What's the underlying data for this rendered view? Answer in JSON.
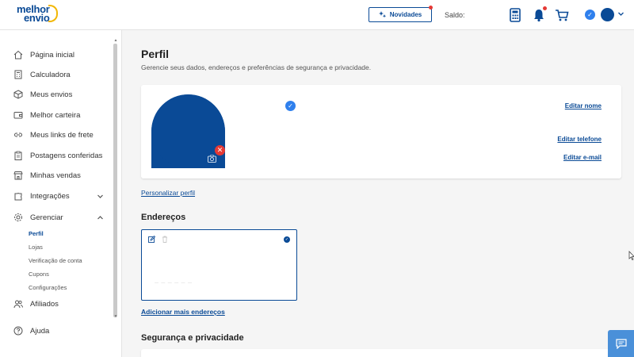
{
  "header": {
    "logo_line1": "melhor",
    "logo_line2": "envio",
    "novidades_label": "Novidades",
    "saldo_label": "Saldo:"
  },
  "sidebar": {
    "items": [
      {
        "label": "Página inicial",
        "icon": "home-icon"
      },
      {
        "label": "Calculadora",
        "icon": "calculator-icon"
      },
      {
        "label": "Meus envios",
        "icon": "box-icon"
      },
      {
        "label": "Melhor carteira",
        "icon": "wallet-icon"
      },
      {
        "label": "Meus links de frete",
        "icon": "link-icon"
      },
      {
        "label": "Postagens conferidas",
        "icon": "clipboard-icon"
      },
      {
        "label": "Minhas vendas",
        "icon": "store-icon"
      },
      {
        "label": "Integrações",
        "icon": "puzzle-icon"
      },
      {
        "label": "Gerenciar",
        "icon": "gear-icon"
      },
      {
        "label": "Afiliados",
        "icon": "users-icon"
      },
      {
        "label": "Ajuda",
        "icon": "help-icon"
      }
    ],
    "subitems": [
      {
        "label": "Perfil",
        "active": true
      },
      {
        "label": "Lojas",
        "active": false
      },
      {
        "label": "Verificação de conta",
        "active": false
      },
      {
        "label": "Cupons",
        "active": false
      },
      {
        "label": "Configurações",
        "active": false
      }
    ]
  },
  "main": {
    "title": "Perfil",
    "subtitle": "Gerencie seus dados, endereços e preferências de segurança e privacidade.",
    "profile_card": {
      "edit_name": "Editar nome",
      "edit_phone": "Editar telefone",
      "edit_email": "Editar e-mail"
    },
    "personalize_link": "Personalizar perfil",
    "addresses_title": "Endereços",
    "add_address_link": "Adicionar mais endereços",
    "security_title": "Segurança e privacidade"
  },
  "colors": {
    "brand_blue": "#0a4a96",
    "alert_red": "#e53935",
    "verified_blue": "#2f80ed",
    "chat_blue": "#4a90d9"
  }
}
